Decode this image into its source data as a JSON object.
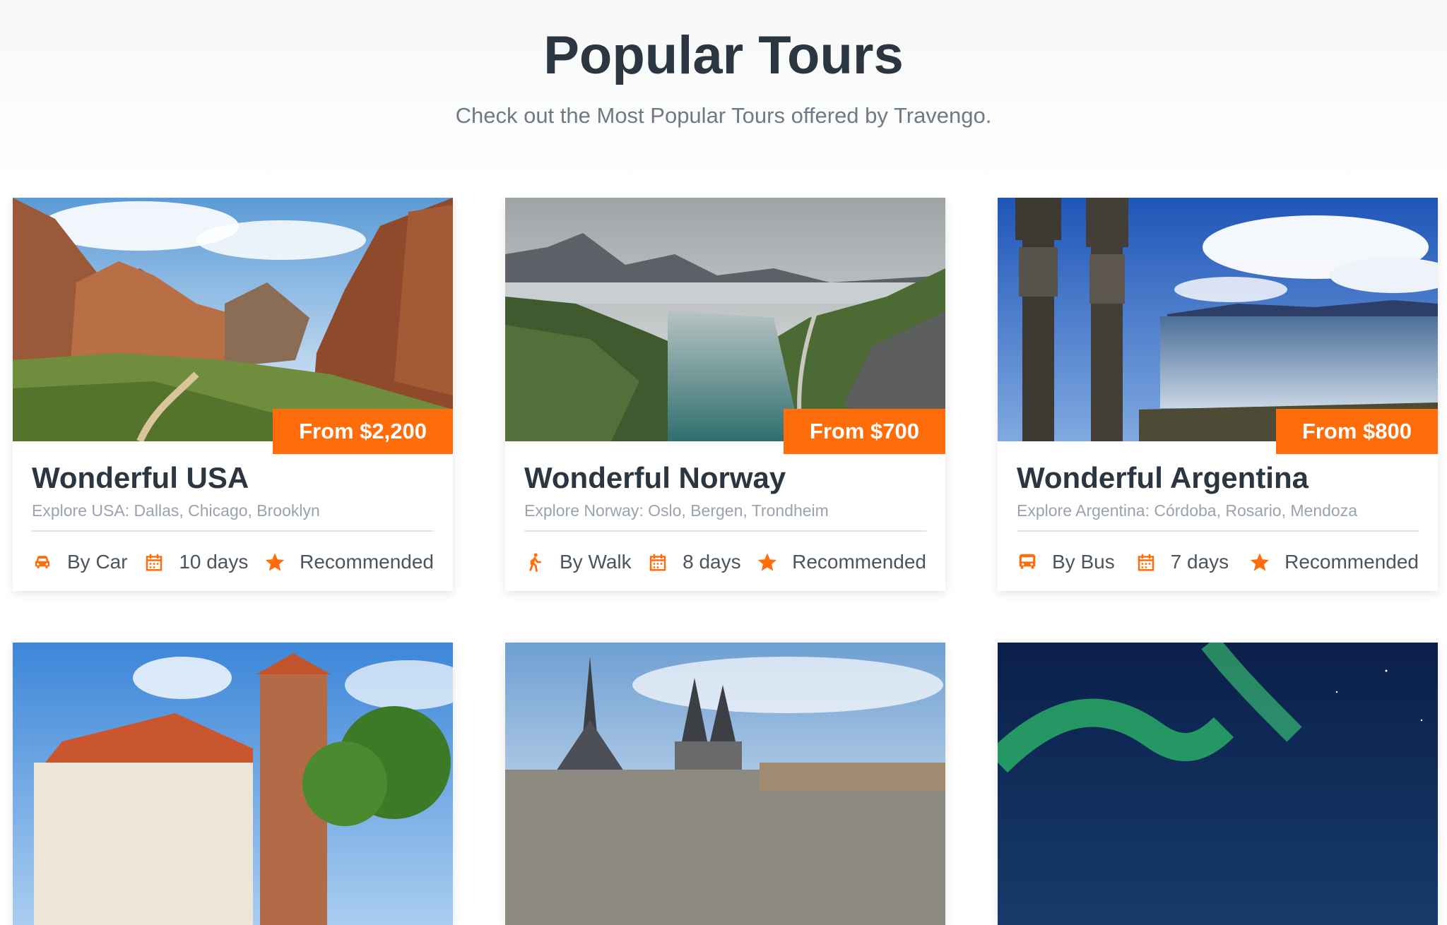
{
  "header": {
    "title": "Popular Tours",
    "subtitle": "Check out the Most Popular Tours offered by Travengo."
  },
  "colors": {
    "accent": "#ff6c0a",
    "heading": "#2c3640",
    "muted": "#9aa3ad"
  },
  "tours": [
    {
      "price": "From $2,200",
      "title": "Wonderful USA",
      "description": "Explore USA: Dallas, Chicago, Brooklyn",
      "transport_icon": "car-icon",
      "transport": "By Car",
      "duration": "10 days",
      "badge": "Recommended"
    },
    {
      "price": "From $700",
      "title": "Wonderful Norway",
      "description": "Explore Norway: Oslo, Bergen, Trondheim",
      "transport_icon": "walk-icon",
      "transport": "By Walk",
      "duration": "8 days",
      "badge": "Recommended"
    },
    {
      "price": "From $800",
      "title": "Wonderful Argentina",
      "description": "Explore Argentina: Córdoba, Rosario, Mendoza",
      "transport_icon": "bus-icon",
      "transport": "By Bus",
      "duration": "7 days",
      "badge": "Recommended"
    }
  ],
  "icons": {
    "duration": "calendar-icon",
    "badge": "star-icon"
  }
}
